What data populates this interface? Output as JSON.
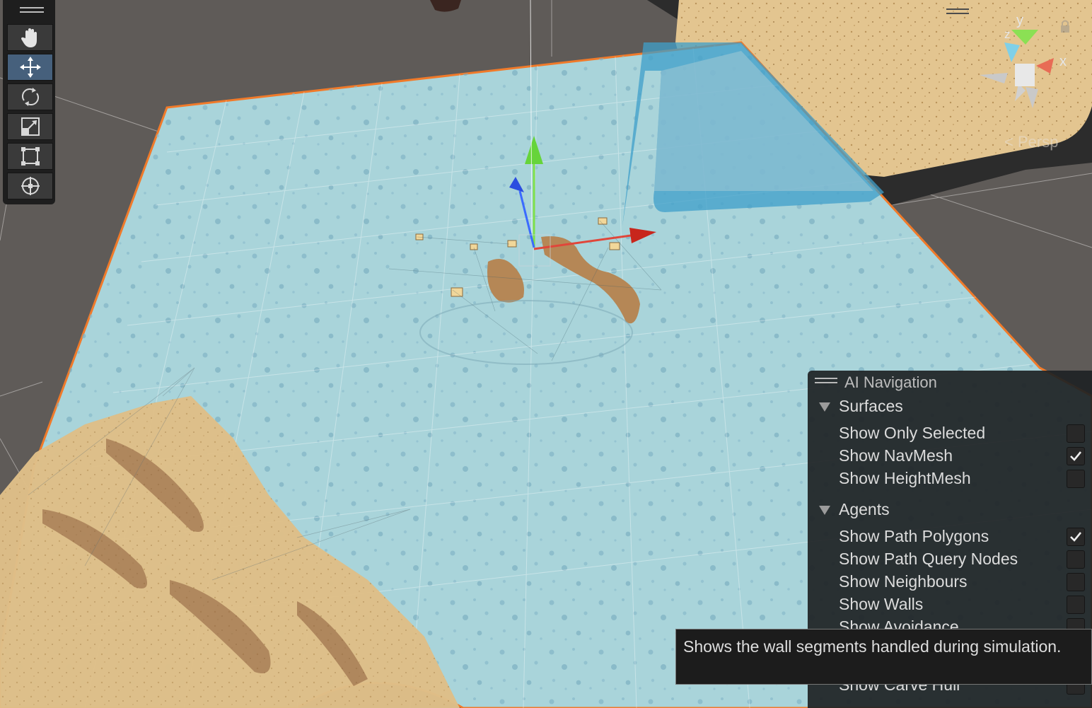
{
  "scene": {
    "view_mode": "Persp",
    "axis_labels": {
      "y": "y",
      "x": "x",
      "z": "z"
    }
  },
  "toolbar": {
    "tools": [
      "hand-tool",
      "move-tool",
      "rotate-tool",
      "scale-tool",
      "rect-tool",
      "transform-tool"
    ],
    "active_tool": "move-tool"
  },
  "ai_navigation": {
    "title": "AI Navigation",
    "surfaces": {
      "label": "Surfaces",
      "options": [
        {
          "label": "Show Only Selected",
          "checked": false
        },
        {
          "label": "Show NavMesh",
          "checked": true
        },
        {
          "label": "Show HeightMesh",
          "checked": false
        }
      ]
    },
    "agents": {
      "label": "Agents",
      "options": [
        {
          "label": "Show Path Polygons",
          "checked": true
        },
        {
          "label": "Show Path Query Nodes",
          "checked": false
        },
        {
          "label": "Show Neighbours",
          "checked": false
        },
        {
          "label": "Show Walls",
          "checked": false
        },
        {
          "label": "Show Avoidance",
          "checked": false
        },
        {
          "label": "Show Carve Hull",
          "checked": false
        }
      ]
    }
  },
  "tooltip": {
    "text": "Shows the wall segments handled during simulation."
  },
  "colors": {
    "navmesh": "#a9d4da",
    "selection_outline": "#f07a2a",
    "sand": "#d8b67e",
    "panel_bg": "#1e2224",
    "active_tool": "#46607c"
  }
}
